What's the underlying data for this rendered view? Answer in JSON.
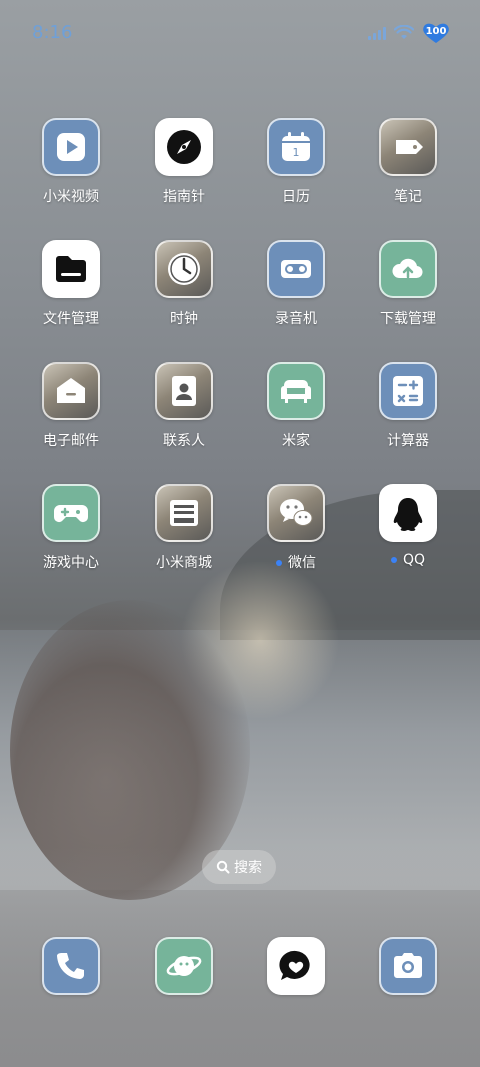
{
  "status": {
    "time": "8:16",
    "battery": "100",
    "icons": [
      "signal-icon",
      "wifi-icon",
      "battery-heart-icon"
    ]
  },
  "apps": [
    {
      "label": "小米视频",
      "icon": "video-play-icon",
      "style": "blue",
      "dot": false
    },
    {
      "label": "指南针",
      "icon": "compass-icon",
      "style": "white",
      "dot": false
    },
    {
      "label": "日历",
      "icon": "calendar-icon",
      "style": "blue",
      "dot": false
    },
    {
      "label": "笔记",
      "icon": "tag-note-icon",
      "style": "photo",
      "dot": false
    },
    {
      "label": "文件管理",
      "icon": "folder-icon",
      "style": "white",
      "dot": false
    },
    {
      "label": "时钟",
      "icon": "clock-icon",
      "style": "photo",
      "dot": false
    },
    {
      "label": "录音机",
      "icon": "recorder-icon",
      "style": "blue",
      "dot": false
    },
    {
      "label": "下载管理",
      "icon": "cloud-download-icon",
      "style": "green",
      "dot": false
    },
    {
      "label": "电子邮件",
      "icon": "mail-icon",
      "style": "photo",
      "dot": false
    },
    {
      "label": "联系人",
      "icon": "contact-card-icon",
      "style": "photo",
      "dot": false
    },
    {
      "label": "米家",
      "icon": "sofa-icon",
      "style": "green",
      "dot": false
    },
    {
      "label": "计算器",
      "icon": "calculator-icon",
      "style": "blue",
      "dot": false
    },
    {
      "label": "游戏中心",
      "icon": "gamepad-icon",
      "style": "green",
      "dot": false
    },
    {
      "label": "小米商城",
      "icon": "store-icon",
      "style": "photo",
      "dot": false
    },
    {
      "label": "微信",
      "icon": "wechat-icon",
      "style": "photo",
      "dot": true
    },
    {
      "label": "QQ",
      "icon": "qq-penguin-icon",
      "style": "white",
      "dot": true
    }
  ],
  "calendar_day": "1",
  "search": {
    "label": "搜索"
  },
  "dock": [
    {
      "icon": "phone-icon",
      "style": "blue"
    },
    {
      "icon": "planet-icon",
      "style": "green"
    },
    {
      "icon": "chat-heart-icon",
      "style": "white"
    },
    {
      "icon": "camera-icon",
      "style": "blue"
    }
  ],
  "colors": {
    "blue": "#6d8fb9",
    "green": "#76b49a",
    "status": "#6fa0d8",
    "dot": "#3b82f6"
  }
}
